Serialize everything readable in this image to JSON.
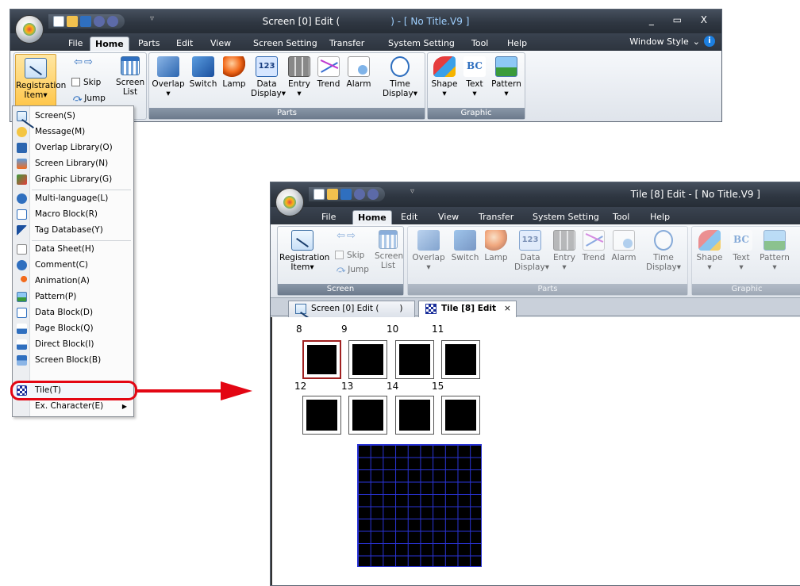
{
  "window1": {
    "title": "Screen [0] Edit (",
    "title_suffix": ") - [ No Title.V9 ]",
    "window_controls": "_ ▭ X",
    "tabs": [
      "File",
      "Home",
      "Parts",
      "Edit",
      "View",
      "Screen Setting",
      "Transfer",
      "System Setting",
      "Tool",
      "Help"
    ],
    "active_tab": "Home",
    "window_style": "Window Style",
    "ribbon": {
      "reg_label_1": "Registration",
      "reg_label_2": "Item",
      "skip": "Skip",
      "jump": "Jump",
      "screen_list_1": "Screen",
      "screen_list_2": "List",
      "parts": [
        "Overlap",
        "Switch",
        "Lamp"
      ],
      "data_display_1": "Data",
      "data_display_2": "Display",
      "entry": "Entry",
      "trend": "Trend",
      "alarm": "Alarm",
      "time_display_1": "Time",
      "time_display_2": "Display",
      "data_icon_text": "123",
      "parts_group": "Parts",
      "graphic_group": "Graphic",
      "shape": "Shape",
      "text": "Text",
      "pattern": "Pattern",
      "text_icon": "BC"
    }
  },
  "menu": {
    "items": [
      "Screen(S)",
      "Message(M)",
      "Overlap Library(O)",
      "Screen Library(N)",
      "Graphic Library(G)",
      "Multi-language(L)",
      "Macro Block(R)",
      "Tag Database(Y)",
      "Data Sheet(H)",
      "Comment(C)",
      "Animation(A)",
      "Pattern(P)",
      "Data Block(D)",
      "Page Block(Q)",
      "Direct Block(I)",
      "Screen Block(B)",
      "Tile(T)",
      "Ex. Character(E)"
    ]
  },
  "window2": {
    "title": "Tile [8] Edit - [ No Title.V9 ]",
    "tabs": [
      "File",
      "Home",
      "Edit",
      "View",
      "Transfer",
      "System Setting",
      "Tool",
      "Help"
    ],
    "active_tab": "Home",
    "screen_group": "Screen",
    "doc_tab_1": "Screen [0] Edit (",
    "doc_tab_1_suffix": ")",
    "doc_tab_2": "Tile [8] Edit",
    "close": "×",
    "tile_numbers": [
      "8",
      "9",
      "10",
      "11",
      "12",
      "13",
      "14",
      "15"
    ]
  }
}
